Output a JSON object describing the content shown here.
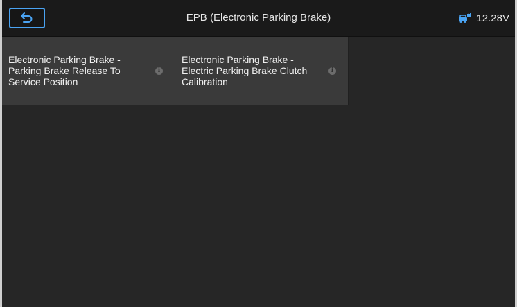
{
  "header": {
    "title": "EPB (Electronic Parking Brake)",
    "voltage": "12.28V",
    "accent_color": "#4aa3f2",
    "back_icon": "back-arrow-icon",
    "battery_icon": "vehicle-battery-icon"
  },
  "tiles": [
    {
      "label": "Electronic Parking Brake - Parking Brake Release To Service Position",
      "info_icon": "info-icon"
    },
    {
      "label": "Electronic Parking Brake - Electric Parking Brake Clutch Calibration",
      "info_icon": "info-icon"
    }
  ]
}
